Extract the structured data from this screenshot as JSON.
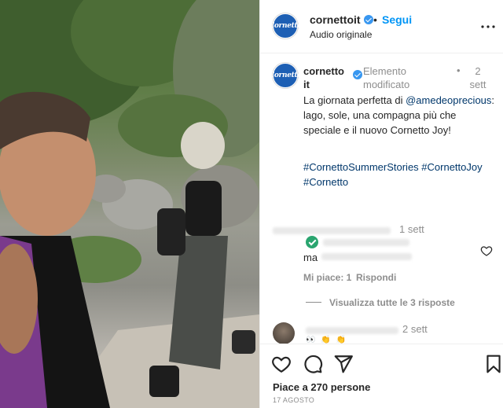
{
  "header": {
    "username": "cornettoit",
    "dot": "•",
    "follow_label": "Segui",
    "audio": "Audio originale",
    "avatar_text": "Cornetto"
  },
  "caption": {
    "username_line1": "cornetto",
    "username_line2": "it",
    "edited_line1": "Elemento",
    "edited_line2": "modificato",
    "dot": "•",
    "time_line1": "2",
    "time_line2": "sett",
    "text_before": "La giornata perfetta di ",
    "mention": "@amedeoprecious",
    "text_after": ": lago, sole, una compagna più che speciale e il nuovo Cornetto Joy!",
    "hashtags": "#CornettoSummerStories #CornettoJoy #Cornetto"
  },
  "comment1": {
    "time": "1 sett",
    "text_fragment": "ma",
    "likes": "Mi piace: 1",
    "reply": "Rispondi",
    "view_replies": "Visualizza tutte le 3 risposte"
  },
  "comment2": {
    "time": "2 sett",
    "emoji": "👀 👏 👏"
  },
  "actions": {
    "likes_text": "Piace a 270 persone",
    "date": "17 AGOSTO"
  },
  "colors": {
    "link": "#0095f6",
    "brand": "#1d5fb4",
    "muted": "#8e8e8e",
    "verified": "#3897f0"
  }
}
